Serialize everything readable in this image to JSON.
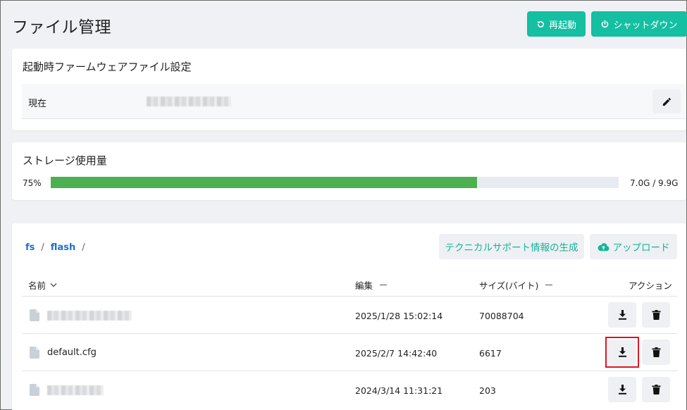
{
  "header": {
    "title": "ファイル管理",
    "restart_label": "再起動",
    "shutdown_label": "シャットダウン"
  },
  "firmware": {
    "title": "起動時ファームウェアファイル設定",
    "current_label": "現在",
    "current_value_redacted": true
  },
  "storage": {
    "title": "ストレージ使用量",
    "percent_label": "75%",
    "percent_value": 0.75,
    "usage_label": "7.0G / 9.9G"
  },
  "files": {
    "breadcrumb": [
      {
        "label": "fs",
        "separator": "/"
      },
      {
        "label": "flash",
        "separator": "/"
      }
    ],
    "support_button_label": "テクニカルサポート情報の生成",
    "upload_button_label": "アップロード",
    "columns": {
      "name": "名前",
      "edited": "編集",
      "size": "サイズ(バイト)",
      "action": "アクション"
    },
    "rows": [
      {
        "name": "",
        "name_redacted": true,
        "edited": "2025/1/28 15:02:14",
        "size": "70088704"
      },
      {
        "name": "default.cfg",
        "name_redacted": false,
        "edited": "2025/2/7 14:42:40",
        "size": "6617",
        "download_highlighted": true
      },
      {
        "name": "",
        "name_redacted": true,
        "edited": "2024/3/14 11:31:21",
        "size": "203"
      }
    ]
  },
  "colors": {
    "teal": "#14bfa2",
    "progress_green": "#4caf50",
    "link_blue": "#1a73c9",
    "highlight_red": "#e0141e"
  },
  "icons": [
    "restart-icon",
    "power-icon",
    "pencil-icon",
    "cloud-upload-icon",
    "file-icon",
    "download-icon",
    "trash-icon",
    "chevron-down-icon"
  ]
}
